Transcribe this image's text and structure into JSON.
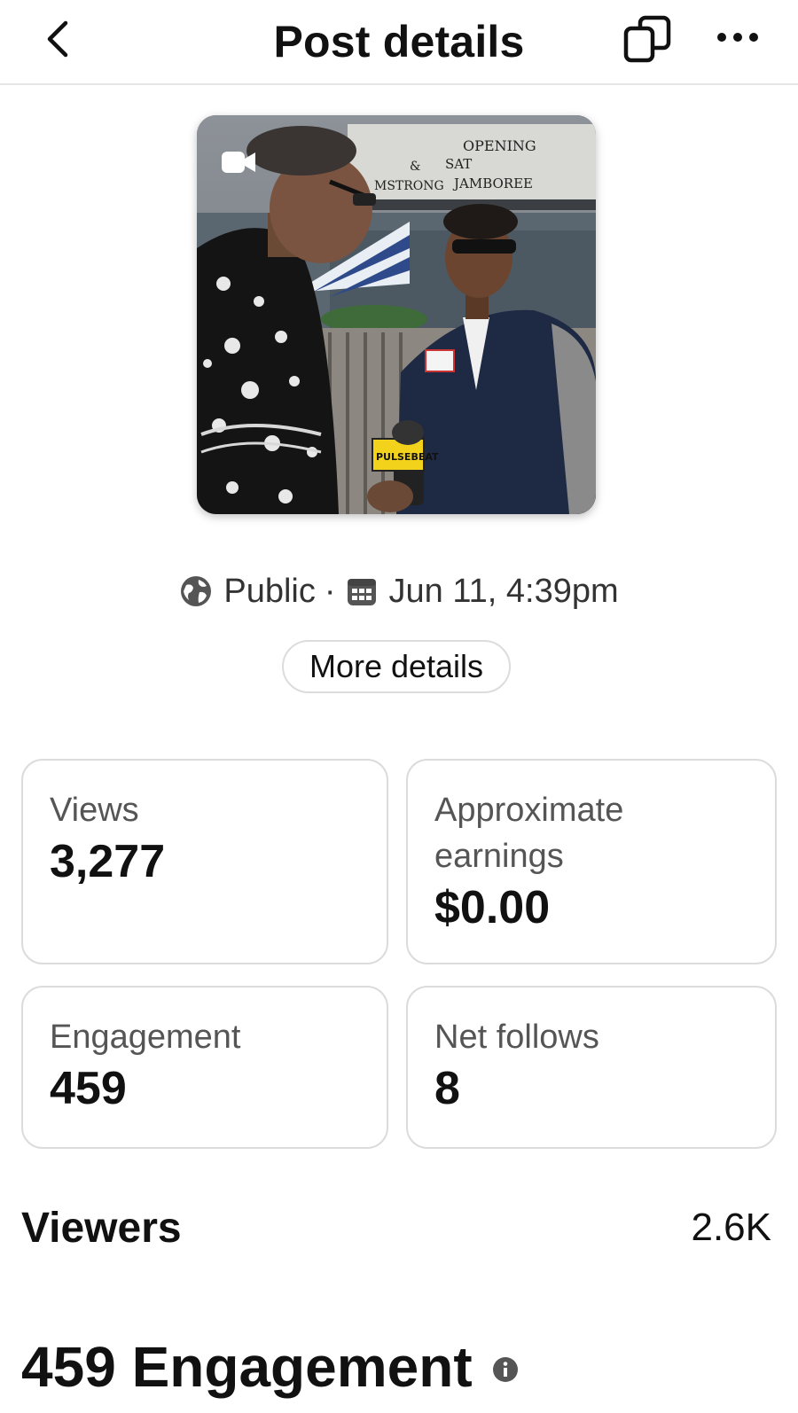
{
  "header": {
    "title": "Post details",
    "back_icon": "chevron-left-icon",
    "copy_icon": "copy-icon",
    "more_icon": "more-horizontal-icon"
  },
  "thumbnail": {
    "media_icon": "video-camera-icon",
    "signage": [
      "OPENING",
      "&",
      "SAT",
      "MSTRONG",
      "JAMBOREE"
    ],
    "mic_flag": "PULSEBEAT"
  },
  "meta": {
    "audience": "Public",
    "separator": "·",
    "date": "Jun 11, 4:39pm",
    "audience_icon": "globe-icon",
    "date_icon": "calendar-icon"
  },
  "more_details_label": "More details",
  "stats": {
    "views": {
      "label": "Views",
      "value": "3,277"
    },
    "earnings": {
      "label_line1": "Approximate",
      "label_line2": "earnings",
      "value": "$0.00"
    },
    "engagement": {
      "label": "Engagement",
      "value": "459"
    },
    "net_follows": {
      "label": "Net follows",
      "value": "8"
    }
  },
  "viewers": {
    "label": "Viewers",
    "value": "2.6K"
  },
  "engagement_section": {
    "title": "459 Engagement",
    "info_icon": "info-icon"
  },
  "colors": {
    "text": "#111111",
    "muted": "#555555",
    "border": "#dcdcdc"
  }
}
